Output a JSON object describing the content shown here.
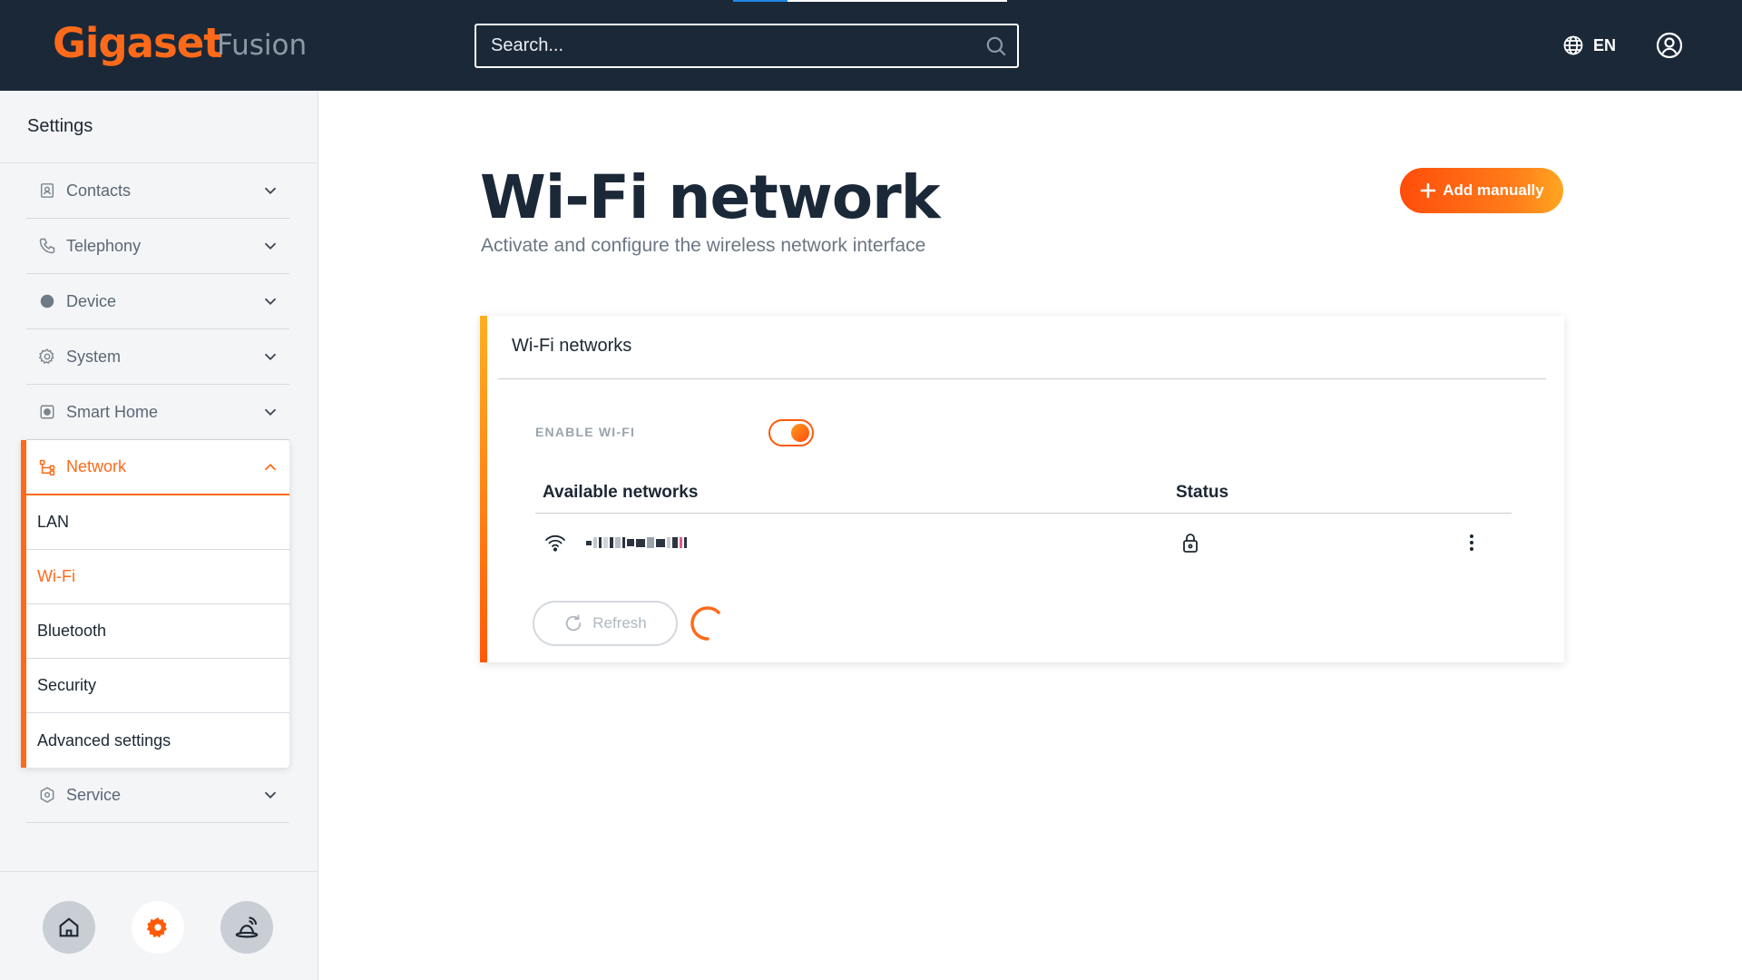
{
  "header": {
    "logo": "Gigaset",
    "product": "Fusion",
    "search_placeholder": "Search...",
    "language": "EN"
  },
  "sidebar": {
    "title": "Settings",
    "items": [
      {
        "label": "Contacts",
        "icon": "contacts-icon"
      },
      {
        "label": "Telephony",
        "icon": "phone-icon"
      },
      {
        "label": "Device",
        "icon": "device-icon"
      },
      {
        "label": "System",
        "icon": "gear-icon"
      },
      {
        "label": "Smart Home",
        "icon": "smart-home-icon"
      },
      {
        "label": "Network",
        "icon": "network-icon",
        "expanded": true
      },
      {
        "label": "Service",
        "icon": "service-icon"
      }
    ],
    "network_sub": [
      {
        "label": "LAN",
        "active": false
      },
      {
        "label": "Wi-Fi",
        "active": true
      },
      {
        "label": "Bluetooth",
        "active": false
      },
      {
        "label": "Security",
        "active": false
      },
      {
        "label": "Advanced settings",
        "active": false
      }
    ],
    "dock": [
      "home-icon",
      "settings-gear-icon",
      "smart-home-device-icon"
    ]
  },
  "main": {
    "title": "Wi-Fi network",
    "subtitle": "Activate and configure the wireless network interface",
    "add_button": "Add manually",
    "card": {
      "title": "Wi-Fi networks",
      "enable_label": "ENABLE WI-FI",
      "enabled": true,
      "columns": {
        "networks": "Available networks",
        "status": "Status"
      },
      "rows": [
        {
          "signal_icon": "wifi-icon",
          "status_icon": "lock-icon"
        }
      ],
      "refresh_label": "Refresh"
    }
  },
  "colors": {
    "header_bg": "#1b2838",
    "accent": "#ff6a1a",
    "sidebar_bg": "#f4f5f7"
  }
}
